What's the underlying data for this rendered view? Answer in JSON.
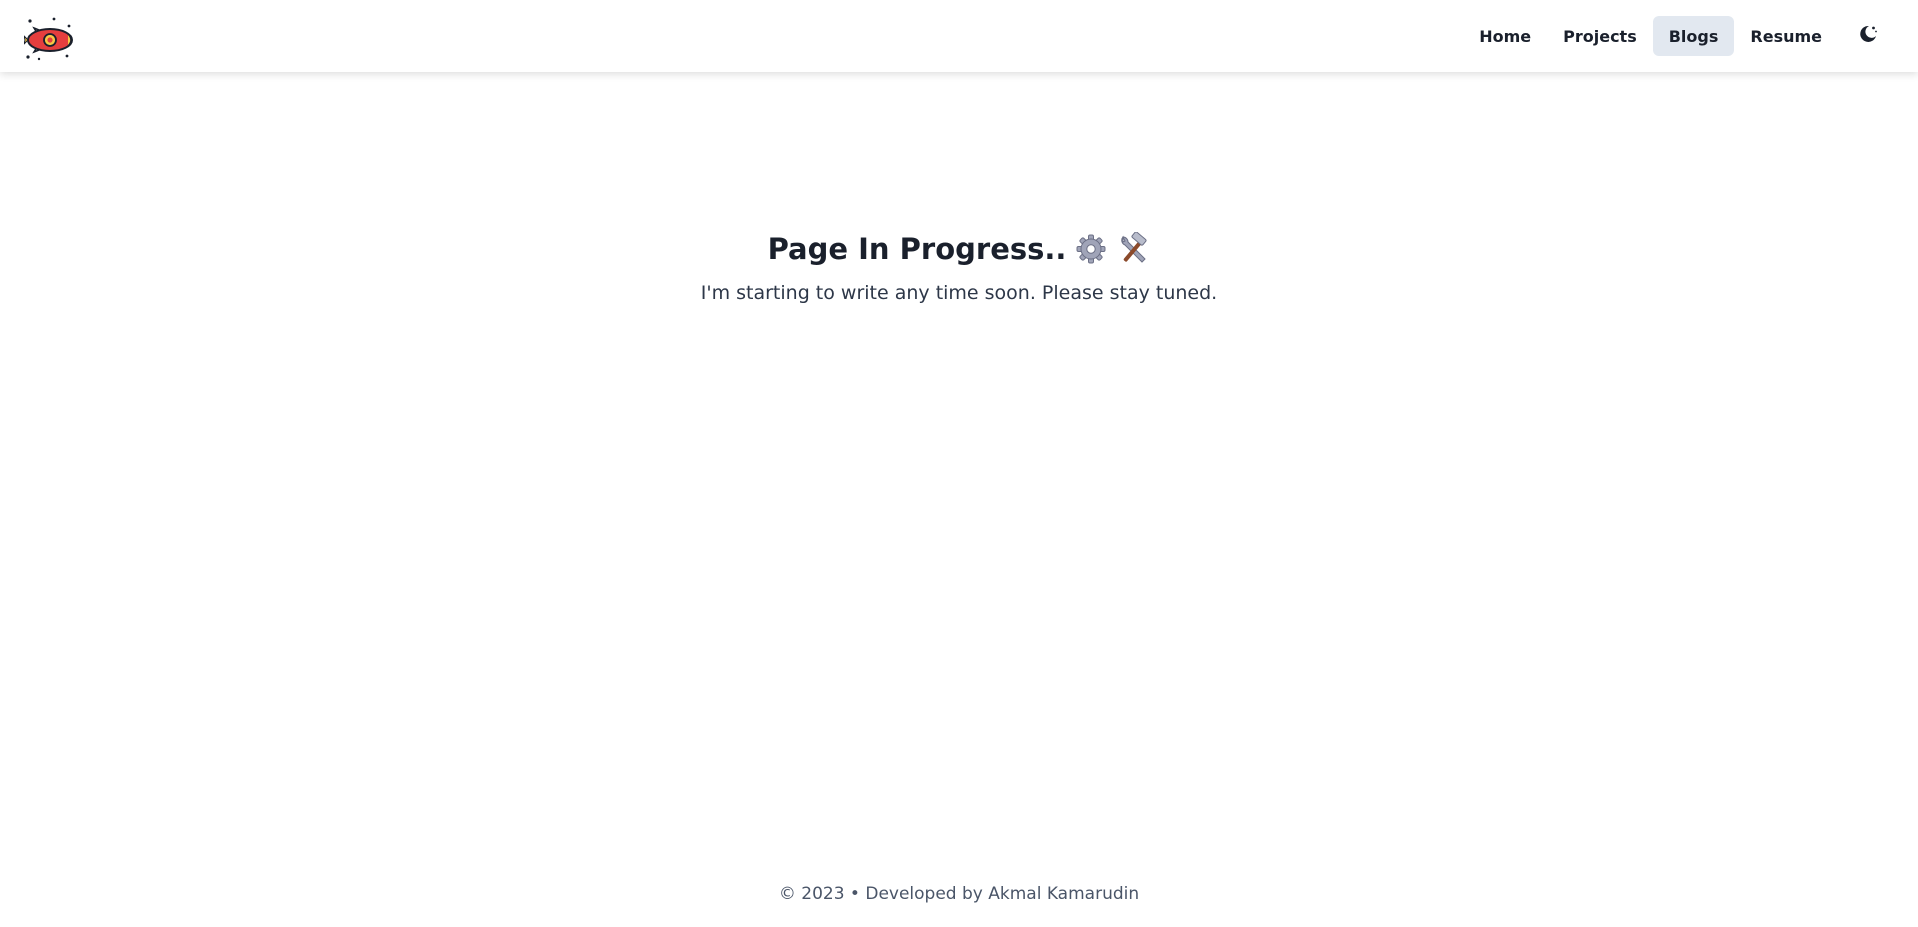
{
  "header": {
    "logo_icon": "rocket-logo-icon",
    "nav": [
      {
        "label": "Home",
        "active": false
      },
      {
        "label": "Projects",
        "active": false
      },
      {
        "label": "Blogs",
        "active": true
      },
      {
        "label": "Resume",
        "active": false
      }
    ],
    "theme_toggle_icon": "moon-icon"
  },
  "main": {
    "title": "Page In Progress..",
    "title_icons": [
      "gear-icon",
      "hammer-wrench-icon"
    ],
    "subtitle": "I'm starting to write any time soon. Please stay tuned."
  },
  "footer": {
    "text": "© 2023 • Developed by Akmal Kamarudin"
  },
  "colors": {
    "text": "#1a202c",
    "active_nav_bg": "#e2e8f0",
    "logo_red": "#e53e3e",
    "logo_yellow": "#f6c945"
  }
}
